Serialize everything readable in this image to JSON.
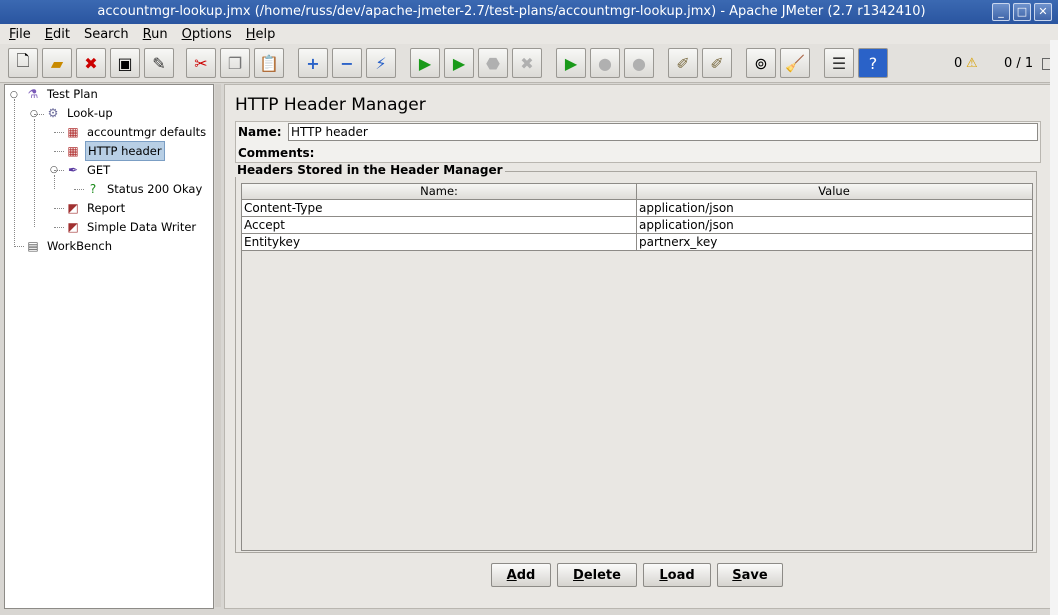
{
  "window": {
    "title": "accountmgr-lookup.jmx (/home/russ/dev/apache-jmeter-2.7/test-plans/accountmgr-lookup.jmx) - Apache JMeter (2.7 r1342410)",
    "buttons": [
      "minimize",
      "maximize",
      "close"
    ]
  },
  "menu": [
    {
      "key": "F",
      "rest": "ile"
    },
    {
      "key": "E",
      "rest": "dit"
    },
    {
      "key": "",
      "rest": "Search"
    },
    {
      "key": "R",
      "rest": "un"
    },
    {
      "key": "O",
      "rest": "ptions"
    },
    {
      "key": "H",
      "rest": "elp"
    }
  ],
  "toolbar": {
    "icons": [
      "new-icon",
      "open-icon",
      "close-file-icon",
      "save-icon",
      "save-as-icon",
      "cut-icon",
      "copy-icon",
      "paste-icon",
      "expand-icon",
      "collapse-icon",
      "toggle-icon",
      "start-icon",
      "start-no-pause-icon",
      "stop-icon",
      "shutdown-icon",
      "remote-start-icon",
      "remote-stop-icon",
      "remote-shutdown-icon",
      "clear-icon",
      "clear-all-icon",
      "search-icon",
      "reset-search-icon",
      "function-helper-icon",
      "help-icon"
    ],
    "errors_count": "0",
    "warning_icon": "warning-icon",
    "threads": "0 / 1"
  },
  "tree": {
    "items": [
      {
        "label": "Test Plan",
        "icon": "test-plan-icon"
      },
      {
        "label": "Look-up",
        "icon": "thread-group-icon"
      },
      {
        "label": "accountmgr defaults",
        "icon": "config-element-icon"
      },
      {
        "label": "HTTP header",
        "icon": "config-element-icon",
        "selected": true
      },
      {
        "label": "GET",
        "icon": "sampler-icon"
      },
      {
        "label": "Status 200 Okay",
        "icon": "assertion-icon"
      },
      {
        "label": "Report",
        "icon": "listener-icon"
      },
      {
        "label": "Simple Data Writer",
        "icon": "listener-icon"
      },
      {
        "label": "WorkBench",
        "icon": "workbench-icon"
      }
    ]
  },
  "panel": {
    "heading": "HTTP Header Manager",
    "name_label": "Name:",
    "name_value": "HTTP header",
    "comments_label": "Comments:",
    "group_title": "Headers Stored in the Header Manager",
    "columns": [
      "Name:",
      "Value"
    ],
    "rows": [
      {
        "name": "Content-Type",
        "value": "application/json"
      },
      {
        "name": "Accept",
        "value": "application/json"
      },
      {
        "name": "Entitykey",
        "value": "partnerx_key"
      }
    ],
    "buttons": [
      {
        "key": "A",
        "rest": "dd"
      },
      {
        "key": "D",
        "rest": "elete"
      },
      {
        "key": "L",
        "rest": "oad"
      },
      {
        "key": "S",
        "rest": "ave"
      }
    ]
  }
}
